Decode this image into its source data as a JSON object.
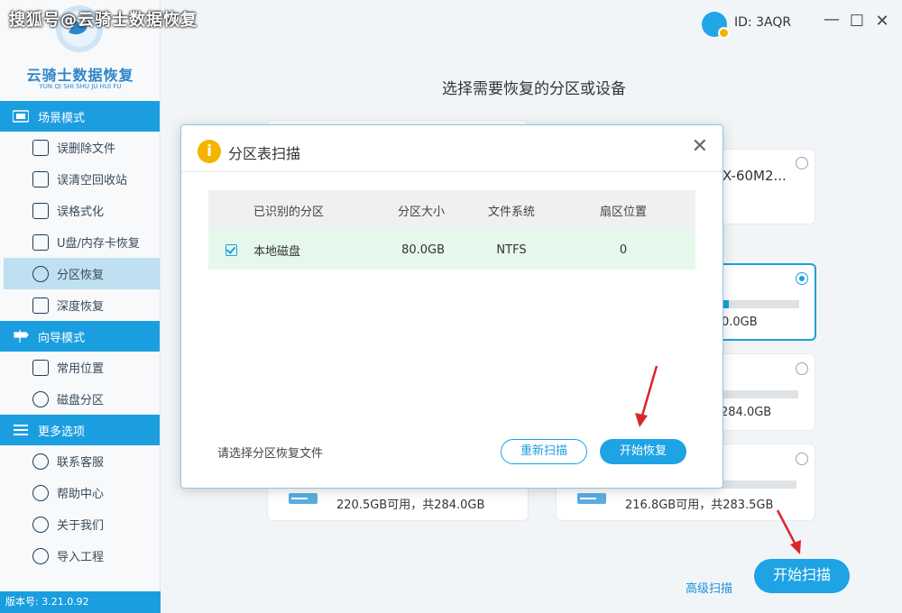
{
  "watermark": "搜狐号@云骑士数据恢复",
  "logo": {
    "title": "云骑士数据恢复",
    "subtitle": "YUN QI SHI SHU JU HUI FU"
  },
  "sidebar": {
    "sections": [
      {
        "label": "场景模式",
        "icon": "scene-icon"
      },
      {
        "label": "向导模式",
        "icon": "signpost-icon"
      },
      {
        "label": "更多选项",
        "icon": "menu-icon"
      }
    ],
    "scene_items": [
      {
        "label": "误删除文件",
        "icon": "delete-file-icon"
      },
      {
        "label": "误清空回收站",
        "icon": "recycle-bin-icon"
      },
      {
        "label": "误格式化",
        "icon": "format-icon"
      },
      {
        "label": "U盘/内存卡恢复",
        "icon": "usb-card-icon"
      },
      {
        "label": "分区恢复",
        "icon": "partition-icon",
        "active": true
      },
      {
        "label": "深度恢复",
        "icon": "deep-recovery-icon"
      }
    ],
    "guide_items": [
      {
        "label": "常用位置",
        "icon": "windows-icon"
      },
      {
        "label": "磁盘分区",
        "icon": "disk-partition-icon"
      }
    ],
    "more_items": [
      {
        "label": "联系客服",
        "icon": "phone-icon"
      },
      {
        "label": "帮助中心",
        "icon": "question-icon"
      },
      {
        "label": "关于我们",
        "icon": "info-icon"
      },
      {
        "label": "导入工程",
        "icon": "import-icon"
      }
    ],
    "version": "版本号: 3.21.0.92"
  },
  "topbar": {
    "id_label": "ID: 3AQR"
  },
  "main": {
    "title": "选择需要恢复的分区或设备",
    "cards": [
      {
        "name_partial": "X-60M2...",
        "selected": false
      },
      {
        "size_partial": "0.0GB",
        "selected": true,
        "usage": 0.05
      },
      {
        "size_partial": "284.0GB",
        "selected": false,
        "usage": 0.0
      },
      {
        "size_partial": "",
        "selected": false,
        "usage": 0.0
      }
    ],
    "bottom_cards": [
      {
        "capacity": "220.5GB可用，共284.0GB"
      },
      {
        "capacity": "216.8GB可用，共283.5GB"
      }
    ],
    "advanced_scan": "高级扫描",
    "start_scan": "开始扫描"
  },
  "dialog": {
    "title": "分区表扫描",
    "columns": [
      "已识别的分区",
      "分区大小",
      "文件系统",
      "扇区位置"
    ],
    "rows": [
      {
        "name": "本地磁盘",
        "size": "80.0GB",
        "fs": "NTFS",
        "sector": "0",
        "checked": true
      }
    ],
    "note": "请选择分区恢复文件",
    "rescan": "重新扫描",
    "recover": "开始恢复"
  },
  "colors": {
    "accent": "#1ea3e4",
    "warning": "#f5b400",
    "row_highlight": "#e6f7ec"
  }
}
